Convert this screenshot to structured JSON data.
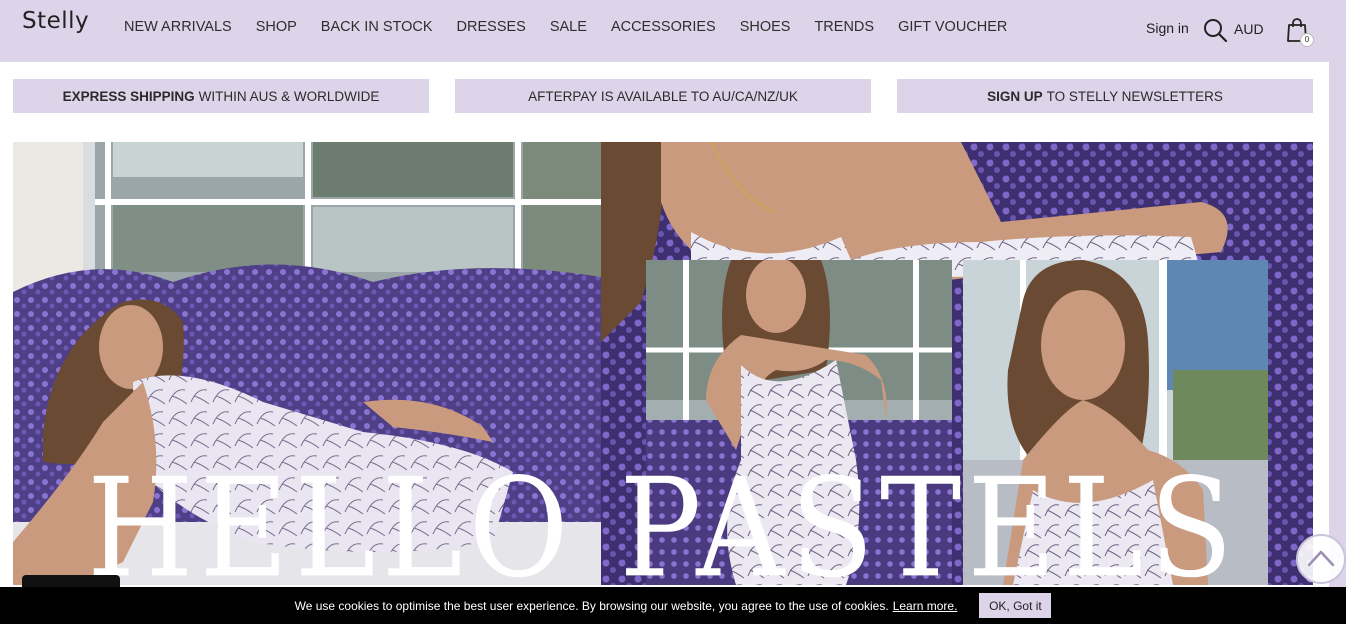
{
  "header": {
    "logo": "Stelly",
    "nav": [
      "NEW ARRIVALS",
      "SHOP",
      "BACK IN STOCK",
      "DRESSES",
      "SALE",
      "ACCESSORIES",
      "SHOES",
      "TRENDS",
      "GIFT VOUCHER"
    ],
    "sign_in": "Sign in",
    "currency": "AUD",
    "cart_count": "0",
    "search_icon": "search-icon",
    "cart_icon": "shopping-bag-icon"
  },
  "promos": [
    {
      "bold": "EXPRESS SHIPPING",
      "text": "WITHIN AUS & WORLDWIDE"
    },
    {
      "bold": "",
      "text": "AFTERPAY IS AVAILABLE TO AU/CA/NZ/UK"
    },
    {
      "bold": "SIGN UP",
      "text": "TO STELLY NEWSLETTERS"
    }
  ],
  "hero": {
    "title": "HELLO PASTELS"
  },
  "cookie": {
    "text": "We use cookies to optimise the best user experience. By browsing our website, you agree to the use of cookies.",
    "link": "Learn more.",
    "button": "OK, Got it"
  },
  "colors": {
    "header_bg": "#ddd4ea",
    "promo_bg": "#ddd4ea",
    "cookie_bg": "#000000",
    "lavender": "#7b64c4"
  }
}
